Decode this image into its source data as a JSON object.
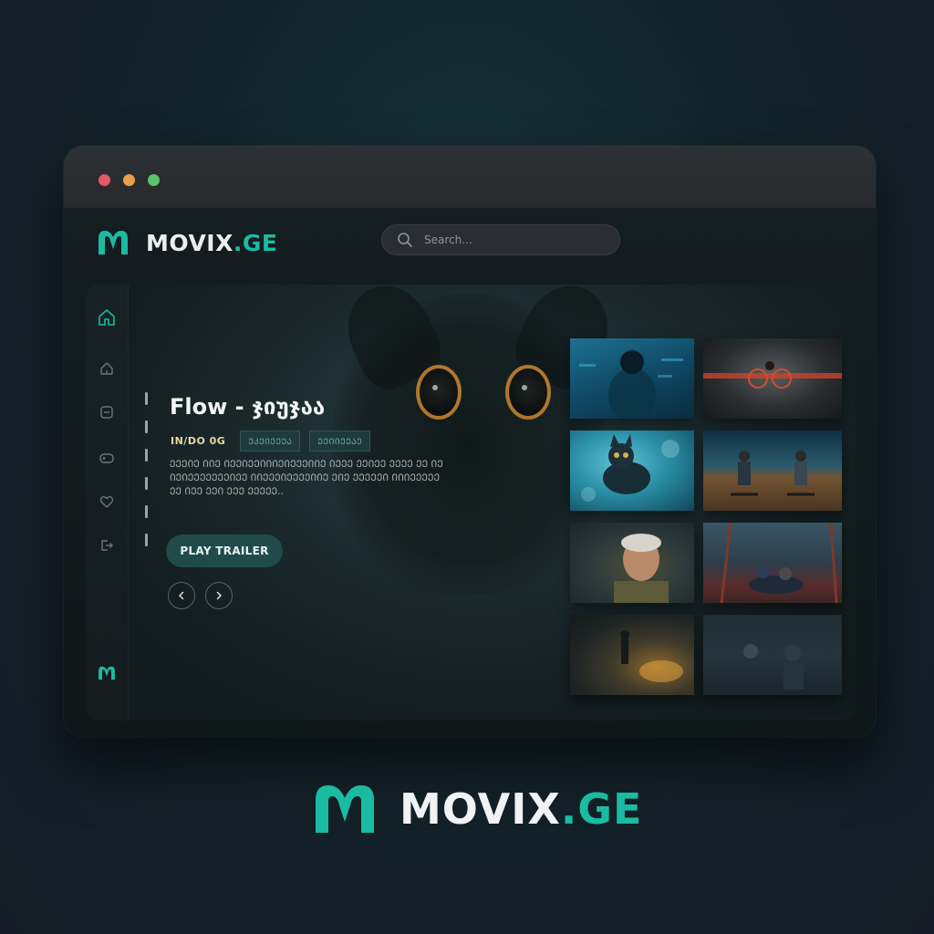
{
  "app": {
    "brand_main": "MOVIX",
    "brand_tld": ".GE",
    "accent_color": "#1bbba2"
  },
  "search": {
    "placeholder": "Search..."
  },
  "sidebar": {
    "items": [
      {
        "icon": "home-icon",
        "active": true
      },
      {
        "icon": "home-outline-icon",
        "active": false
      },
      {
        "icon": "tv-icon",
        "active": false
      },
      {
        "icon": "gamepad-icon",
        "active": false
      },
      {
        "icon": "heart-icon",
        "active": false
      },
      {
        "icon": "logout-icon",
        "active": false
      }
    ],
    "footer_icon": "brand-logo-icon"
  },
  "hero": {
    "title": "Flow - ჯიუჯაა",
    "meta": "IN/DO  0G",
    "tags": [
      "ᲔᲙᲔᲘᲔᲔᲔᲐ",
      "ᲔᲔᲘᲘᲔᲔᲐᲔ"
    ],
    "description": "ᲔᲔᲔᲘᲔ ᲘᲘᲔ ᲘᲔᲔᲘᲔᲔᲘᲘᲘᲔᲘᲔᲔᲔᲘᲘᲔ ᲘᲔᲔᲔ ᲔᲔᲘᲔᲔ ᲔᲔᲔᲔ ᲔᲔ ᲘᲔ ᲘᲔᲘᲔᲔᲔᲔᲔᲔᲔᲘᲔᲔ ᲘᲘᲔᲔᲔᲘᲔᲔᲔᲔᲘᲘᲔ ᲔᲘᲔ ᲔᲔᲔᲔᲔᲘ ᲘᲘᲘᲔᲔᲔᲔᲔ ᲔᲔ ᲘᲔᲔ ᲔᲔᲘ ᲔᲔᲔ ᲔᲔᲔᲔᲔ..",
    "play_label": "PLAY TRAILER",
    "prev_icon": "chevron-left-icon",
    "next_icon": "chevron-right-icon"
  },
  "thumbnails": [
    {
      "name": "thumbnail-figure-underwater",
      "row": 1,
      "col": 1
    },
    {
      "name": "thumbnail-red-bicycle",
      "row": 1,
      "col": 2
    },
    {
      "name": "thumbnail-cat-underwater",
      "row": 2,
      "col": 1
    },
    {
      "name": "thumbnail-beach-chairs",
      "row": 2,
      "col": 2
    },
    {
      "name": "thumbnail-old-man-portrait",
      "row": 3,
      "col": 1
    },
    {
      "name": "thumbnail-boat-scene",
      "row": 3,
      "col": 2
    },
    {
      "name": "thumbnail-fire-scene",
      "row": 4,
      "col": 1
    },
    {
      "name": "thumbnail-dark-room",
      "row": 4,
      "col": 2
    }
  ],
  "footer_brand": {
    "main": "MOVIX",
    "tld": ".GE"
  }
}
